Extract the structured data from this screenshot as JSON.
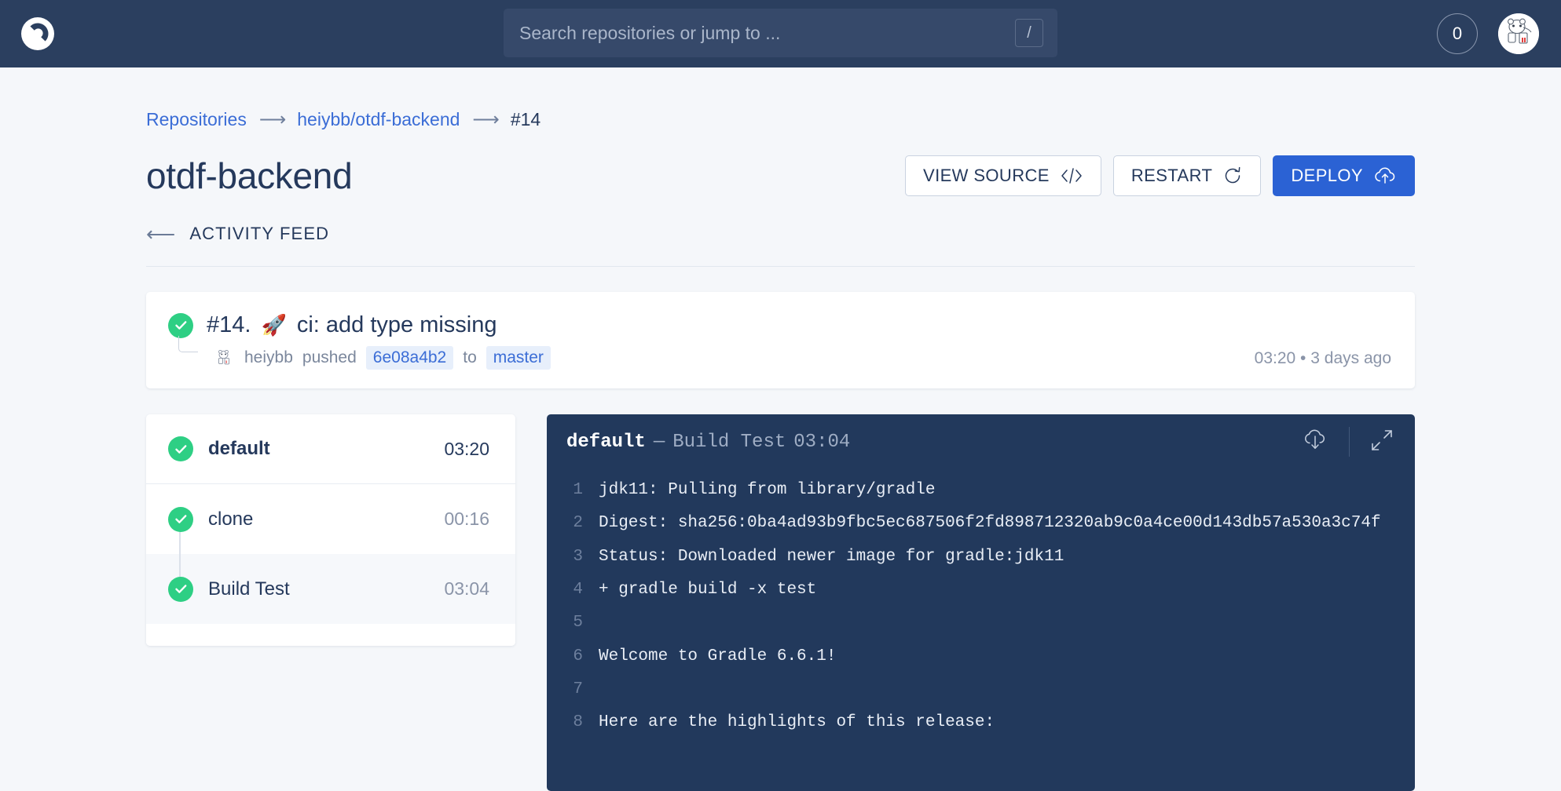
{
  "nav": {
    "logo_icon": "drone-logo-icon",
    "search": {
      "placeholder": "Search repositories or jump to ...",
      "value": "",
      "shortcut_key": "/"
    },
    "notification_count": "0",
    "avatar_alt": "user-avatar"
  },
  "breadcrumb": {
    "repositories": "Repositories",
    "repo": "heiybb/otdf-backend",
    "build": "#14",
    "separator": "⟶"
  },
  "header": {
    "title": "otdf-backend",
    "buttons": {
      "view_source": "VIEW SOURCE",
      "restart": "RESTART",
      "deploy": "DEPLOY"
    },
    "activity_feed": "ACTIVITY FEED",
    "back_arrow": "⟵"
  },
  "build": {
    "number": "#14.",
    "event_emoji": "🚀",
    "message": "ci: add type missing",
    "author": "heiybb",
    "action": "pushed",
    "commit": "6e08a4b2",
    "preposition": "to",
    "branch": "master",
    "time": "03:20",
    "time_sep": "•",
    "relative": "3 days ago",
    "status": "success"
  },
  "steps": [
    {
      "name": "default",
      "duration": "03:20",
      "status": "success",
      "type": "stage",
      "selected": false
    },
    {
      "name": "clone",
      "duration": "00:16",
      "status": "success",
      "type": "step",
      "selected": false
    },
    {
      "name": "Build Test",
      "duration": "03:04",
      "status": "success",
      "type": "step",
      "selected": true
    }
  ],
  "log_panel": {
    "stage": "default",
    "dash": "—",
    "step": "Build Test",
    "duration": "03:04",
    "download_icon": "cloud-download-icon",
    "expand_icon": "expand-icon",
    "lines": [
      {
        "n": "1",
        "text": "jdk11: Pulling from library/gradle"
      },
      {
        "n": "2",
        "text": "Digest: sha256:0ba4ad93b9fbc5ec687506f2fd898712320ab9c0a4ce00d143db57a530a3c74f"
      },
      {
        "n": "3",
        "text": "Status: Downloaded newer image for gradle:jdk11"
      },
      {
        "n": "4",
        "text": "+ gradle build -x test"
      },
      {
        "n": "5",
        "text": ""
      },
      {
        "n": "6",
        "text": "Welcome to Gradle 6.6.1!"
      },
      {
        "n": "7",
        "text": ""
      },
      {
        "n": "8",
        "text": "Here are the highlights of this release:"
      }
    ]
  },
  "colors": {
    "nav_bg": "#2b3f5f",
    "page_bg": "#f5f7fa",
    "accent_blue": "#2b62d4",
    "link_blue": "#3b6dd6",
    "success_green": "#2ecf84",
    "log_bg": "#22395c"
  }
}
